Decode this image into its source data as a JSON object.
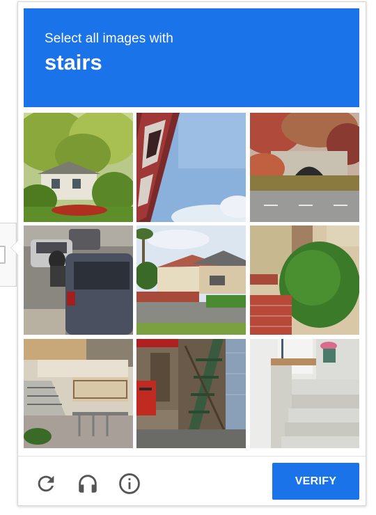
{
  "challenge": {
    "prompt": "Select all images with",
    "keyword": "stairs",
    "header_color": "#1a73e8"
  },
  "grid": {
    "rows": 3,
    "cols": 3,
    "tiles": [
      {
        "content": "house with trees and garden"
      },
      {
        "content": "sky with tilted signpost"
      },
      {
        "content": "stone bridge with autumn trees"
      },
      {
        "content": "motorcycle and cars on road"
      },
      {
        "content": "suburban houses on street"
      },
      {
        "content": "green bush by brick wall"
      },
      {
        "content": "building with outdoor stairs and fence"
      },
      {
        "content": "wooden staircase by red postbox"
      },
      {
        "content": "stone steps with flower pot"
      }
    ]
  },
  "footer": {
    "reload_icon": "reload-icon",
    "audio_icon": "headphones-icon",
    "info_icon": "info-icon",
    "verify_label": "VERIFY",
    "icon_color": "#555555",
    "button_color": "#1a73e8"
  }
}
